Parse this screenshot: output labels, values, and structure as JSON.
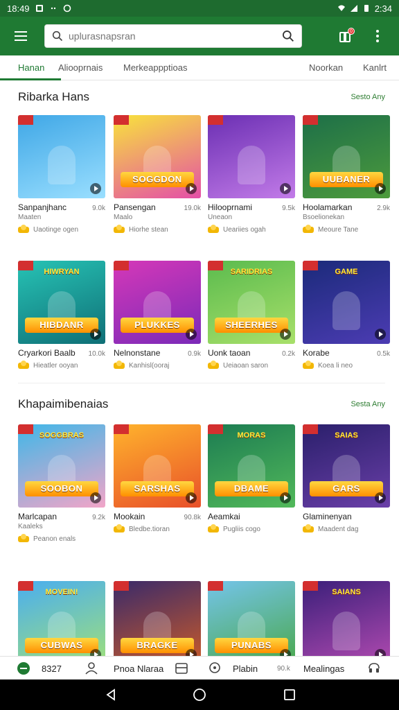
{
  "status_bar": {
    "time_left": "18:49",
    "time_right": "2:34"
  },
  "app_bar": {
    "search_placeholder": "uplurasnapsran",
    "cart_badge": "0"
  },
  "tabs": [
    {
      "label": "Hanan",
      "active": true
    },
    {
      "label": "Aliooprnais",
      "active": false
    },
    {
      "label": "Merkeappptioas",
      "active": false
    },
    {
      "label": "Noorkan",
      "active": false
    },
    {
      "label": "Kanlrt",
      "active": false
    }
  ],
  "sections": [
    {
      "title": "Ribarka Hans",
      "see_all": "Sesto Any",
      "rows": [
        [
          {
            "title": "Sanpanjhanc",
            "size": "9.0k",
            "sub": "Maaten",
            "meta": "Uaotinge ogen",
            "logo": "",
            "banner": "",
            "bg": [
              "#3fa7e6",
              "#9adfff"
            ]
          },
          {
            "title": "Pansengan",
            "size": "19.0k",
            "sub": "Maalo",
            "meta": "Hiorhe stean",
            "logo": "",
            "banner": "SOGGDON",
            "bg": [
              "#f8e33c",
              "#e44fa7"
            ]
          },
          {
            "title": "Hilooprnami",
            "size": "9.5k",
            "sub": "Uneaon",
            "meta": "Ueariies ogah",
            "logo": "",
            "banner": "",
            "bg": [
              "#6b2fb3",
              "#c27be8"
            ]
          },
          {
            "title": "Hoolamarkan",
            "size": "2.9k",
            "sub": "Bsoelionekan",
            "meta": "Meoure Tane",
            "logo": "",
            "banner": "UUBANER",
            "bg": [
              "#1d6f48",
              "#4d9b3c"
            ]
          }
        ],
        [
          {
            "title": "Cryarkori Baalb",
            "size": "10.0k",
            "sub": "",
            "meta": "Hieatler ooyan",
            "logo": "HIWRYAN",
            "banner": "HIBDANR",
            "bg": [
              "#27c3b5",
              "#0f6f76"
            ]
          },
          {
            "title": "Nelnonstane",
            "size": "0.9k",
            "sub": "",
            "meta": "Kanhisl(ooraj",
            "logo": "",
            "banner": "PLUKKES",
            "bg": [
              "#d538b8",
              "#7b2ab8"
            ]
          },
          {
            "title": "Uonk taoan",
            "size": "0.2k",
            "sub": "",
            "meta": "Ueiaoan saron",
            "logo": "SARIDRIAS",
            "banner": "SHEERHES",
            "bg": [
              "#5bbb4e",
              "#a8e06a"
            ]
          },
          {
            "title": "Korabe",
            "size": "0.5k",
            "sub": "",
            "meta": "Koea li neo",
            "logo": "GAME",
            "banner": "",
            "bg": [
              "#1b2a7a",
              "#4c3cb3"
            ]
          }
        ]
      ]
    },
    {
      "title": "Khapaimibenaias",
      "see_all": "Sesta Any",
      "rows": [
        [
          {
            "title": "Marlcapan",
            "size": "9.2k",
            "sub": "Kaaleks",
            "meta": "Peanon enals",
            "logo": "SOGGBRAS",
            "banner": "SOOBON",
            "bg": [
              "#3fb7e8",
              "#f2a5c8"
            ]
          },
          {
            "title": "Mookain",
            "size": "90.8k",
            "sub": "",
            "meta": "Bledbe.tioran",
            "logo": "",
            "banner": "SARSHAS",
            "bg": [
              "#ffb32c",
              "#e8502a"
            ]
          },
          {
            "title": "Aeamkai",
            "size": "",
            "sub": "",
            "meta": "Pugliis cogo",
            "logo": "MORAS",
            "banner": "DBAME",
            "bg": [
              "#1c7c52",
              "#52b95a"
            ]
          },
          {
            "title": "Glaminenyan",
            "size": "",
            "sub": "",
            "meta": "Maadent dag",
            "logo": "SAIAS",
            "banner": "GARS",
            "bg": [
              "#2a1f6b",
              "#6a3fa8"
            ]
          }
        ],
        [
          {
            "title": "",
            "size": "",
            "sub": "",
            "meta": "",
            "logo": "MOVEIN!",
            "banner": "CUBWAS",
            "bg": [
              "#4aaef0",
              "#9fe07a"
            ]
          },
          {
            "title": "",
            "size": "",
            "sub": "",
            "meta": "",
            "logo": "",
            "banner": "BRAGKE",
            "bg": [
              "#3a2a6a",
              "#c85a2a"
            ]
          },
          {
            "title": "",
            "size": "",
            "sub": "",
            "meta": "",
            "logo": "",
            "banner": "PUNABS",
            "bg": [
              "#74c4ea",
              "#4aa84c"
            ]
          },
          {
            "title": "",
            "size": "",
            "sub": "",
            "meta": "",
            "logo": "SAIANS",
            "banner": "",
            "bg": [
              "#3b1f7a",
              "#b04ab0"
            ]
          }
        ]
      ]
    }
  ],
  "bottom_nav": [
    {
      "label": "8327",
      "icon": "home-icon"
    },
    {
      "label": "",
      "icon": "person-icon"
    },
    {
      "label": "Pnoa Nlaraa",
      "icon": ""
    },
    {
      "label": "",
      "icon": "store-icon"
    },
    {
      "label": "Plabin",
      "icon": "location-pin-icon"
    },
    {
      "label": "90.k",
      "icon": ""
    },
    {
      "label": "Mealingas",
      "icon": ""
    },
    {
      "label": "",
      "icon": "support-icon"
    }
  ],
  "colors": {
    "brand": "#1f7a33",
    "status_bar": "#1e6b2f",
    "accent_link": "#2e7d32",
    "badge": "#e53935"
  }
}
